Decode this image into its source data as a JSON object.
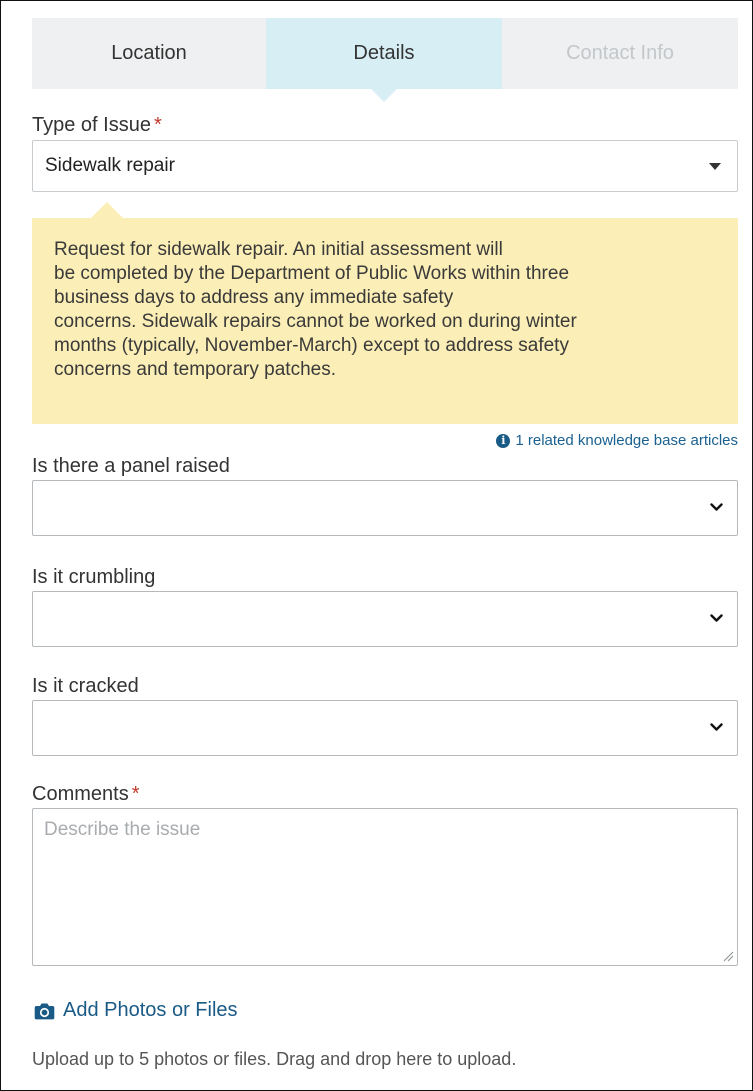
{
  "tabs": [
    {
      "label": "Location",
      "state": "complete"
    },
    {
      "label": "Details",
      "state": "active"
    },
    {
      "label": "Contact Info",
      "state": "disabled"
    }
  ],
  "type_of_issue": {
    "label": "Type of Issue",
    "required_marker": "*",
    "selected": "Sidewalk repair"
  },
  "info_box": {
    "lines": [
      "Request for sidewalk repair. An initial assessment will",
      "be completed by the Department of Public Works within three",
      "business days to address any immediate safety",
      "concerns. Sidewalk repairs cannot be worked on during winter",
      "months (typically, November-March) except to address safety",
      "concerns and temporary patches."
    ]
  },
  "kb_link": {
    "text": "1 related knowledge base articles"
  },
  "questions": [
    {
      "label": "Is there a panel raised",
      "value": ""
    },
    {
      "label": "Is it crumbling",
      "value": ""
    },
    {
      "label": "Is it cracked",
      "value": ""
    }
  ],
  "comments": {
    "label": "Comments",
    "required_marker": "*",
    "placeholder": "Describe the issue",
    "value": ""
  },
  "attachments": {
    "link_text": "Add Photos or Files",
    "hint": "Upload up to 5 photos or files. Drag and drop here to upload."
  },
  "colors": {
    "active_tab": "#d6eef4",
    "inactive_tab": "#eef0f1",
    "info_box": "#fbeeb6",
    "link": "#1a5a86",
    "required": "#c0392b"
  }
}
